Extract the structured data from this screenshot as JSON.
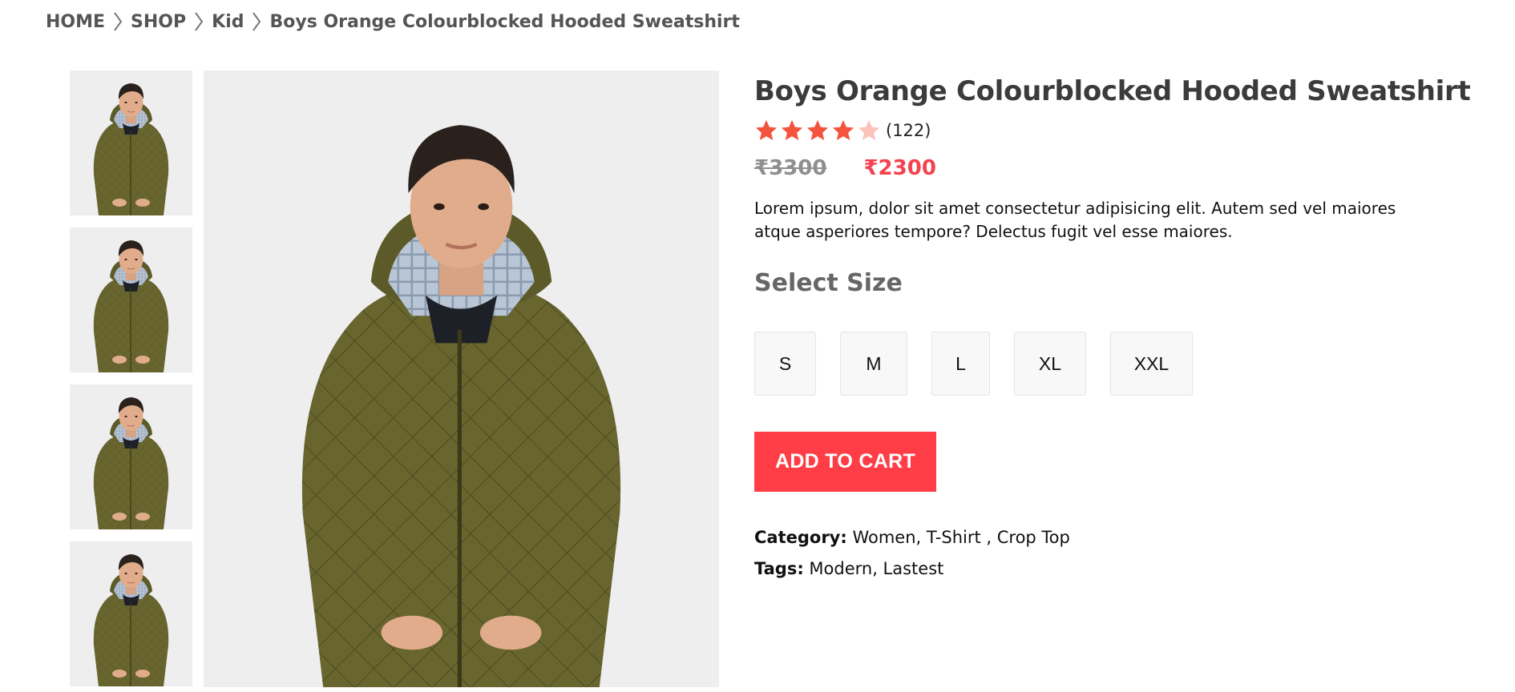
{
  "breadcrumb": {
    "items": [
      "HOME",
      "SHOP",
      "Kid",
      "Boys Orange Colourblocked Hooded Sweatshirt"
    ],
    "separator_icon": "chevron-right-icon"
  },
  "gallery": {
    "thumbnail_count": 4,
    "background": "#efefef"
  },
  "product": {
    "title": "Boys Orange Colourblocked Hooded Sweatshirt",
    "rating": 4,
    "rating_max": 5,
    "review_count": "(122)",
    "old_price": "₹3300",
    "new_price": "₹2300",
    "description": "Lorem ipsum, dolor sit amet consectetur adipisicing elit. Autem sed vel maiores atque asperiores tempore? Delectus fugit vel esse maiores.",
    "select_size_label": "Select Size",
    "sizes": [
      "S",
      "M",
      "L",
      "XL",
      "XXL"
    ],
    "add_to_cart_label": "ADD TO CART",
    "category_label": "Category:",
    "category_value": "Women, T-Shirt , Crop Top",
    "tags_label": "Tags:",
    "tags_value": "Modern, Lastest"
  },
  "colors": {
    "accent": "#ff3d46",
    "price_new": "#f2434f",
    "star_filled": "#f4533e",
    "star_empty": "#fcc3bb",
    "title": "#3b3b3b"
  }
}
